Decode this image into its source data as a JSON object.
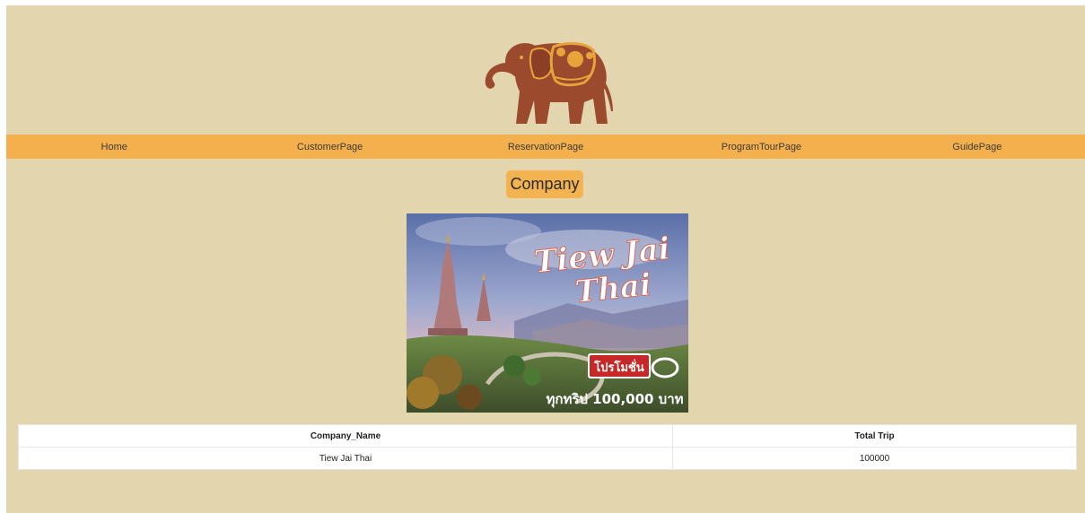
{
  "nav": {
    "items": [
      "Home",
      "CustomerPage",
      "ReservationPage",
      "ProgramTourPage",
      "GuidePage"
    ]
  },
  "company_badge": "Company",
  "banner": {
    "title_line1": "Tiew Jai",
    "title_line2": "Thai",
    "promo": "โปรโมชั่น",
    "price": "ทุกทริป 100,000 บาท"
  },
  "table": {
    "headers": [
      "Company_Name",
      "Total Trip"
    ],
    "rows": [
      [
        "Tiew Jai Thai",
        "100000"
      ]
    ]
  },
  "colors": {
    "background": "#e3d5ad",
    "nav": "#f3b04d",
    "elephant": "#9b4a2e",
    "elephant_accent": "#e8a33a"
  },
  "icons": [
    "elephant-logo-icon"
  ]
}
